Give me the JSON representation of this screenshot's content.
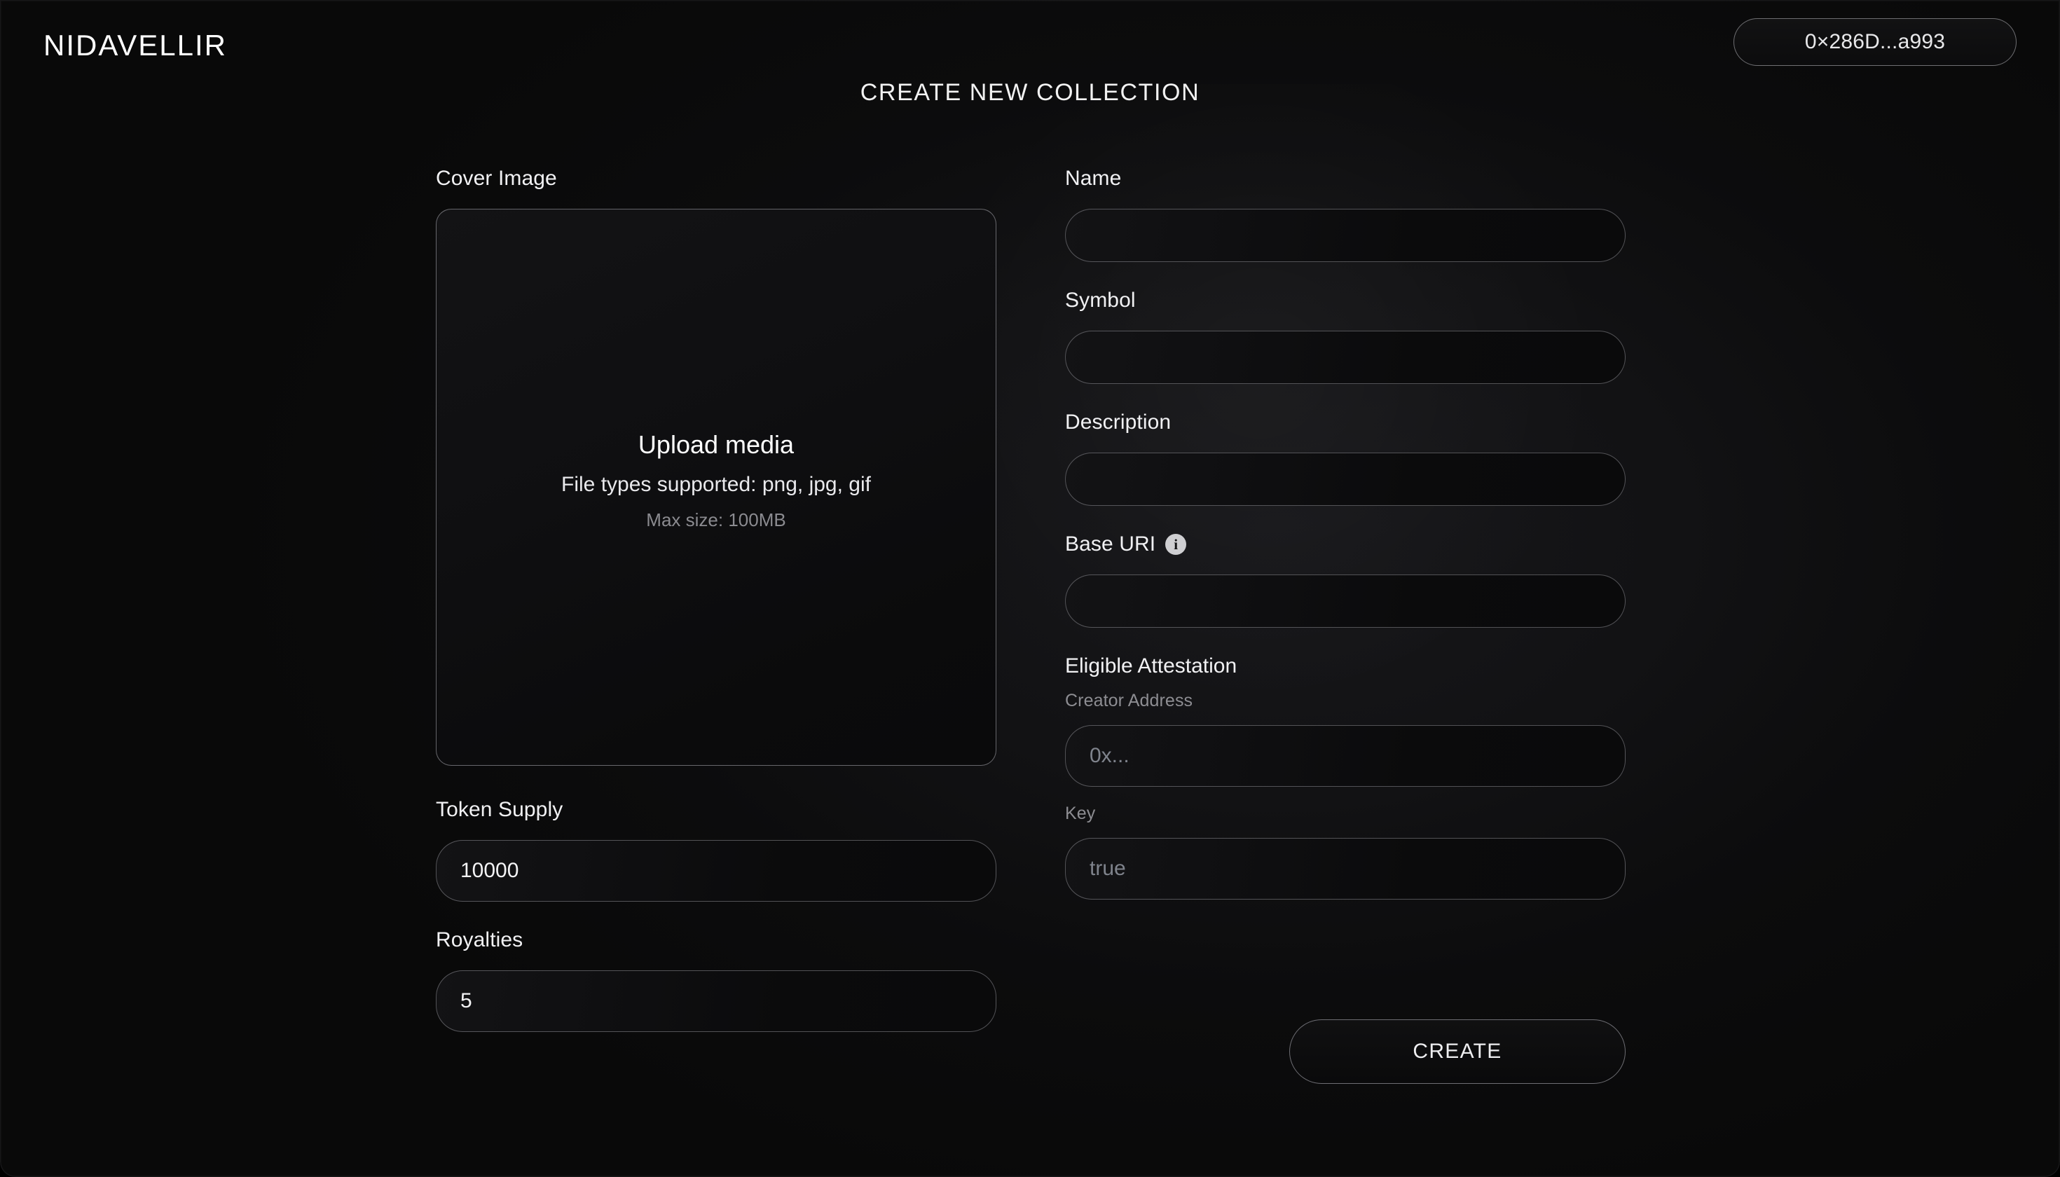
{
  "header": {
    "logo": "NIDAVELLIR",
    "title": "CREATE NEW COLLECTION",
    "wallet_address": "0×286D...a993"
  },
  "left_column": {
    "cover_image": {
      "label": "Cover Image",
      "dropzone": {
        "title": "Upload media",
        "file_types": "File types supported: png, jpg, gif",
        "max_size": "Max size: 100MB"
      }
    },
    "token_supply": {
      "label": "Token Supply",
      "value": "10000",
      "placeholder": ""
    },
    "royalties": {
      "label": "Royalties",
      "value": "5",
      "placeholder": ""
    }
  },
  "right_column": {
    "name": {
      "label": "Name",
      "value": "",
      "placeholder": ""
    },
    "symbol": {
      "label": "Symbol",
      "value": "",
      "placeholder": ""
    },
    "description": {
      "label": "Description",
      "value": "",
      "placeholder": ""
    },
    "base_uri": {
      "label": "Base URI",
      "value": "",
      "placeholder": "",
      "info_glyph": "i"
    },
    "eligible_attestation": {
      "label": "Eligible Attestation",
      "creator_address": {
        "label": "Creator Address",
        "value": "",
        "placeholder": "0x..."
      },
      "key": {
        "label": "Key",
        "value": "",
        "placeholder": "true"
      }
    },
    "create_button": "CREATE"
  },
  "colors": {
    "background": "#0a0a0a",
    "panel_glow": "#17171a",
    "text_primary": "#f2f2f2",
    "text_secondary": "#8d8d92",
    "placeholder": "#7f838c",
    "border": "#a8a8af",
    "info_icon_bg": "#cfcfd2"
  }
}
